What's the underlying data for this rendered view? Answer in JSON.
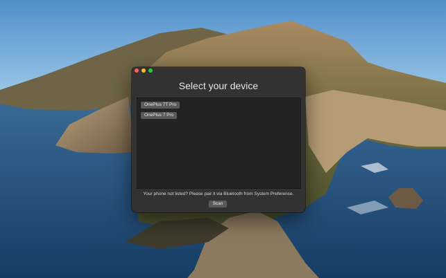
{
  "window": {
    "title": "Select your device",
    "controls": {
      "close_icon": "close-icon",
      "minimize_icon": "minimize-icon",
      "maximize_icon": "maximize-icon"
    }
  },
  "device_list": {
    "items": [
      {
        "label": "OnePlus 7T Pro"
      },
      {
        "label": "OnePlus 7 Pro"
      }
    ]
  },
  "hint": "Your phone not listed? Please pair it via Bluetooth from System Preference.",
  "scan_label": "Scan",
  "colors": {
    "window_bg": "#323232",
    "list_bg": "#232323",
    "button_bg": "#5a5a5a",
    "close": "#fe5f57",
    "minimize": "#febc2e",
    "maximize": "#28c840"
  }
}
